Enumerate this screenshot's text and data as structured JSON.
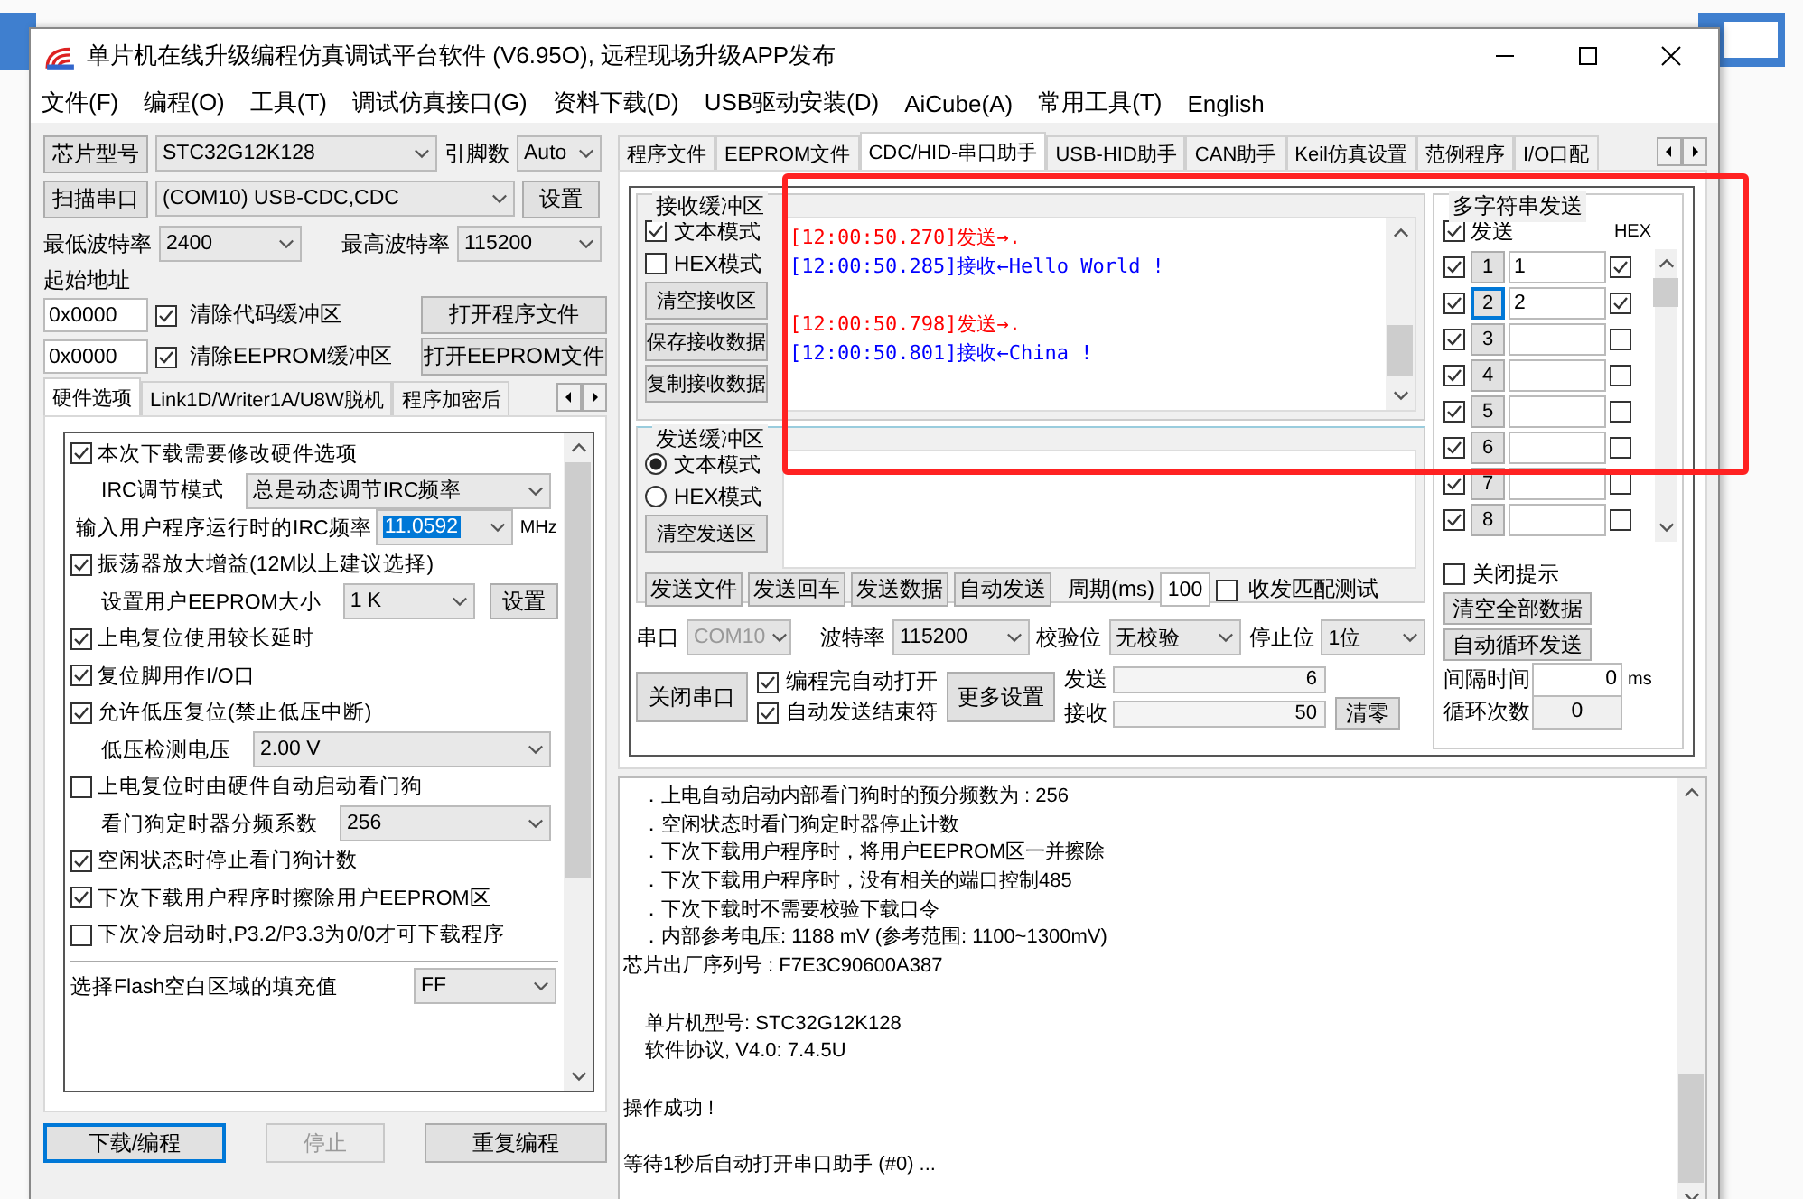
{
  "window": {
    "title": "单片机在线升级编程仿真调试平台软件 (V6.95O), 远程现场升级APP发布"
  },
  "menu": [
    {
      "label": "文件(F)"
    },
    {
      "label": "编程(O)"
    },
    {
      "label": "工具(T)"
    },
    {
      "label": "调试仿真接口(G)"
    },
    {
      "label": "资料下载(D)"
    },
    {
      "label": "USB驱动安装(D)"
    },
    {
      "label": "AiCube(A)"
    },
    {
      "label": "常用工具(T)"
    },
    {
      "label": "English"
    }
  ],
  "left": {
    "chip_button": "芯片型号",
    "chip_value": "STC32G12K128",
    "pins_label": "引脚数",
    "pins_value": "Auto",
    "scan_button": "扫描串口",
    "port_value": "(COM10) USB-CDC,CDC",
    "port_settings_button": "设置",
    "min_baud_label": "最低波特率",
    "min_baud": "2400",
    "max_baud_label": "最高波特率",
    "max_baud": "115200",
    "start_address_label": "起始地址",
    "address_rows": [
      {
        "address": "0x0000",
        "label": "清除代码缓冲区",
        "checked": true,
        "button": "打开程序文件"
      },
      {
        "address": "0x0000",
        "label": "清除EEPROM缓冲区",
        "checked": true,
        "button": "打开EEPROM文件"
      }
    ],
    "tabs": [
      {
        "label": "硬件选项",
        "selected": true
      },
      {
        "label": "Link1D/Writer1A/U8W脱机",
        "selected": false
      },
      {
        "label": "程序加密后",
        "selected": false
      }
    ],
    "options": [
      {
        "kind": "check",
        "label": "本次下载需要修改硬件选项",
        "checked": true
      },
      {
        "kind": "select",
        "label": "IRC调节模式",
        "value": "总是动态调节IRC频率"
      },
      {
        "kind": "input",
        "label": "输入用户程序运行时的IRC频率",
        "value": "11.0592",
        "unit": "MHz"
      },
      {
        "kind": "check",
        "label": "振荡器放大增益(12M以上建议选择)",
        "checked": true
      },
      {
        "kind": "select",
        "label": "设置用户EEPROM大小",
        "value": "1   K",
        "button": "设置"
      },
      {
        "kind": "check",
        "label": "上电复位使用较长延时",
        "checked": true
      },
      {
        "kind": "check",
        "label": "复位脚用作I/O口",
        "checked": true
      },
      {
        "kind": "check",
        "label": "允许低压复位(禁止低压中断)",
        "checked": true
      },
      {
        "kind": "select",
        "label": "低压检测电压",
        "value": "2.00 V"
      },
      {
        "kind": "check",
        "label": "上电复位时由硬件自动启动看门狗",
        "checked": false
      },
      {
        "kind": "select",
        "label": "看门狗定时器分频系数",
        "value": "256"
      },
      {
        "kind": "check",
        "label": "空闲状态时停止看门狗计数",
        "checked": true
      },
      {
        "kind": "check",
        "label": "下次下载用户程序时擦除用户EEPROM区",
        "checked": true
      },
      {
        "kind": "check",
        "label": "下次冷启动时,P3.2/P3.3为0/0才可下载程序",
        "checked": false
      }
    ],
    "flash_fill": {
      "label": "选择Flash空白区域的填充值",
      "value": "FF"
    },
    "buttons": [
      {
        "label": "下载/编程",
        "disabled": false,
        "focused": true
      },
      {
        "label": "停止",
        "disabled": true,
        "focused": false
      },
      {
        "label": "重复编程",
        "disabled": false,
        "focused": false
      }
    ]
  },
  "right": {
    "tabs": [
      {
        "label": "程序文件",
        "selected": false
      },
      {
        "label": "EEPROM文件",
        "selected": false
      },
      {
        "label": "CDC/HID-串口助手",
        "selected": true
      },
      {
        "label": "USB-HID助手",
        "selected": false
      },
      {
        "label": "CAN助手",
        "selected": false
      },
      {
        "label": "Keil仿真设置",
        "selected": false
      },
      {
        "label": "范例程序",
        "selected": false
      },
      {
        "label": "I/O口配",
        "selected": false
      }
    ],
    "receive": {
      "title": "接收缓冲区",
      "modes": [
        {
          "label": "文本模式",
          "checked": true
        },
        {
          "label": "HEX模式",
          "checked": false
        }
      ],
      "buttons": [
        "清空接收区",
        "保存接收数据",
        "复制接收数据"
      ],
      "lines": [
        {
          "kind": "sent",
          "time": "[12:00:50.270]",
          "text": "发送→."
        },
        {
          "kind": "received",
          "time": "[12:00:50.285]",
          "text": "接收←Hello World !"
        },
        {
          "kind": "blank"
        },
        {
          "kind": "sent",
          "time": "[12:00:50.798]",
          "text": "发送→."
        },
        {
          "kind": "received",
          "time": "[12:00:50.801]",
          "text": "接收←China !"
        }
      ]
    },
    "send": {
      "title": "发送缓冲区",
      "modes": [
        {
          "label": "文本模式",
          "selected": true
        },
        {
          "label": "HEX模式",
          "selected": false
        }
      ],
      "clear_button": "清空发送区",
      "buttons": [
        "发送文件",
        "发送回车",
        "发送数据",
        "自动发送"
      ],
      "period_label": "周期(ms)",
      "period": "100",
      "match_test": {
        "label": "收发匹配测试",
        "checked": false
      }
    },
    "serial": {
      "port_label": "串口",
      "port": "COM10",
      "port_disabled": true,
      "baud_label": "波特率",
      "baud": "115200",
      "parity_label": "校验位",
      "parity": "无校验",
      "stop_label": "停止位",
      "stop": "1位"
    },
    "close_button": "关闭串口",
    "options": [
      {
        "label": "编程完自动打开",
        "checked": true
      },
      {
        "label": "自动发送结束符",
        "checked": true
      }
    ],
    "more_button": "更多设置",
    "counters": [
      {
        "label": "发送",
        "value": "6"
      },
      {
        "label": "接收",
        "value": "50"
      }
    ],
    "reset_button": "清零",
    "multi": {
      "title": "多字符串发送",
      "send_all": {
        "label": "发送",
        "checked": true
      },
      "hex_label": "HEX",
      "rows": [
        {
          "send": true,
          "number": "1",
          "value": "1",
          "hex": true,
          "focused": false
        },
        {
          "send": true,
          "number": "2",
          "value": "2",
          "hex": true,
          "focused": true
        },
        {
          "send": true,
          "number": "3",
          "hex": false,
          "focused": false
        },
        {
          "send": true,
          "number": "4",
          "hex": false,
          "focused": false
        },
        {
          "send": true,
          "number": "5",
          "hex": false,
          "focused": false
        },
        {
          "send": true,
          "number": "6",
          "hex": false,
          "focused": false
        },
        {
          "send": true,
          "number": "7",
          "hex": false,
          "focused": false
        },
        {
          "send": true,
          "number": "8",
          "hex": false,
          "focused": false
        }
      ],
      "close_hint": {
        "label": "关闭提示",
        "checked": false
      },
      "clear_button": "清空全部数据",
      "loop_button": "自动循环发送",
      "interval_label": "间隔时间",
      "interval": "0",
      "interval_unit": "ms",
      "loop_count_label": "循环次数",
      "loop_count": "0"
    }
  },
  "log": [
    {
      "kind": "bullet",
      "text": "．上电自动启动内部看门狗时的预分频数为 : 256"
    },
    {
      "kind": "bullet",
      "text": "．空闲状态时看门狗定时器停止计数"
    },
    {
      "kind": "bullet",
      "text": "．下次下载用户程序时，将用户EEPROM区一并擦除"
    },
    {
      "kind": "bullet",
      "text": "．下次下载用户程序时，没有相关的端口控制485"
    },
    {
      "kind": "bullet",
      "text": "．下次下载时不需要校验下载口令"
    },
    {
      "kind": "bullet",
      "text": "．内部参考电压: 1188 mV (参考范围: 1100~1300mV)"
    },
    {
      "kind": "plain",
      "text": "芯片出厂序列号 : F7E3C90600A387"
    },
    {
      "kind": "blank"
    },
    {
      "kind": "indented",
      "text": "单片机型号: STC32G12K128"
    },
    {
      "kind": "indented",
      "text": "软件协议, V4.0: 7.4.5U"
    },
    {
      "kind": "blank"
    },
    {
      "kind": "plain",
      "text": "操作成功 !"
    },
    {
      "kind": "blank"
    },
    {
      "kind": "plain",
      "text": "等待1秒后自动打开串口助手 (#0) ..."
    }
  ]
}
